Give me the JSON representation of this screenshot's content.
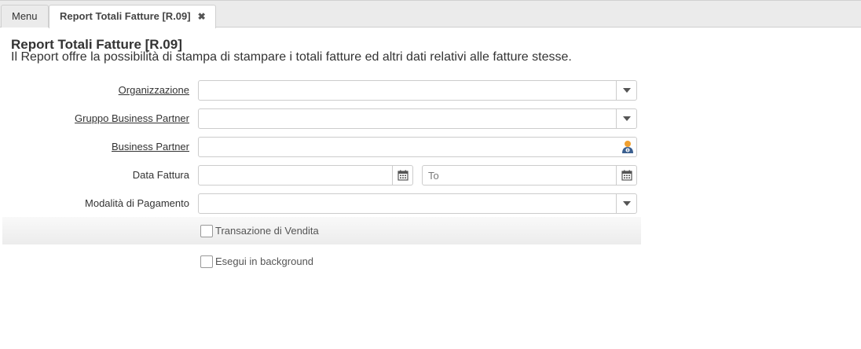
{
  "tabs": {
    "menu_label": "Menu",
    "active_label": "Report Totali Fatture [R.09]",
    "close_glyph": "✖"
  },
  "page": {
    "title": "Report Totali Fatture [R.09]",
    "description": "Il Report offre la possibilità di stampa di stampare i totali fatture ed altri dati relativi alle fatture stesse."
  },
  "form": {
    "organizzazione": {
      "label": "Organizzazione",
      "value": ""
    },
    "gruppo_bp": {
      "label": "Gruppo Business Partner",
      "value": ""
    },
    "business_partner": {
      "label": "Business Partner",
      "value": "",
      "icon": "business-partner-search-icon"
    },
    "data_fattura": {
      "label": "Data Fattura",
      "from_value": "",
      "to_placeholder": "To",
      "icon": "calendar-icon"
    },
    "modalita_pagamento": {
      "label": "Modalità di Pagamento",
      "value": ""
    },
    "transazione_vendita": {
      "label": "Transazione di Vendita",
      "checked": false
    },
    "esegui_background": {
      "label": "Esegui in background",
      "checked": false
    }
  }
}
